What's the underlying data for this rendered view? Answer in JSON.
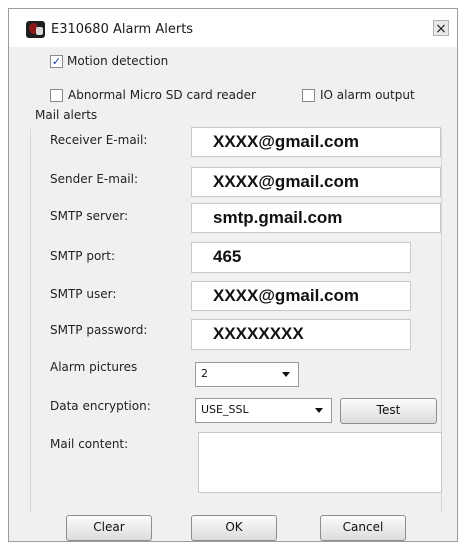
{
  "window": {
    "title": "E310680 Alarm Alerts",
    "close_glyph": "×"
  },
  "motion_detection": {
    "label": "Motion detection",
    "checked": true
  },
  "sd_card_reader": {
    "label": "Abnormal Micro SD card reader",
    "checked": false
  },
  "io_alarm_output": {
    "label": "IO alarm output",
    "checked": false
  },
  "mail_alerts": {
    "group_label": "Mail alerts",
    "receiver_email": {
      "label": "Receiver E-mail:",
      "value": "XXXX@gmail.com"
    },
    "sender_email": {
      "label": "Sender E-mail:",
      "value": "XXXX@gmail.com"
    },
    "smtp_server": {
      "label": "SMTP server:",
      "value": "smtp.gmail.com"
    },
    "smtp_port": {
      "label": "SMTP port:",
      "value": "465"
    },
    "smtp_user": {
      "label": "SMTP user:",
      "value": "XXXX@gmail.com"
    },
    "smtp_password": {
      "label": "SMTP password:",
      "value": "XXXXXXXX"
    },
    "alarm_pictures": {
      "label": "Alarm pictures",
      "value": "2"
    },
    "data_encryption": {
      "label": "Data encryption:",
      "value": "USE_SSL"
    },
    "test_button": "Test",
    "mail_content": {
      "label": "Mail content:",
      "value": ""
    }
  },
  "footer": {
    "clear_label": "Clear",
    "ok_label": "OK",
    "cancel_label": "Cancel"
  },
  "icons": {
    "app": "camera-app-icon",
    "close": "close-icon",
    "check": "checkmark-icon",
    "dropdown": "chevron-down-icon"
  }
}
